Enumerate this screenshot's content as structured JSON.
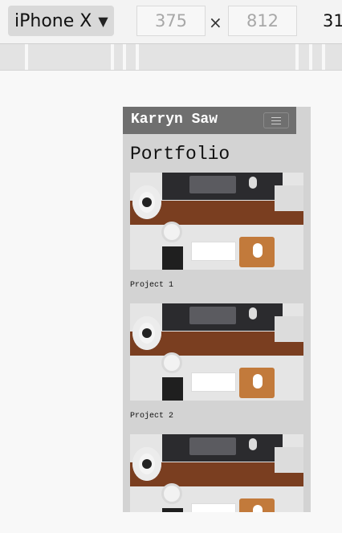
{
  "toolbar": {
    "device_name": "iPhone X",
    "device_dropdown_icon": "triangle-down-icon",
    "width_value": "375",
    "height_value": "812",
    "times_symbol": "×",
    "zoom_value": "31"
  },
  "site": {
    "brand": "Karryn Saw",
    "menu_icon": "hamburger-menu-icon",
    "page_title": "Portfolio",
    "projects": [
      {
        "caption": "Project 1"
      },
      {
        "caption": "Project 2"
      },
      {
        "caption": ""
      }
    ]
  }
}
